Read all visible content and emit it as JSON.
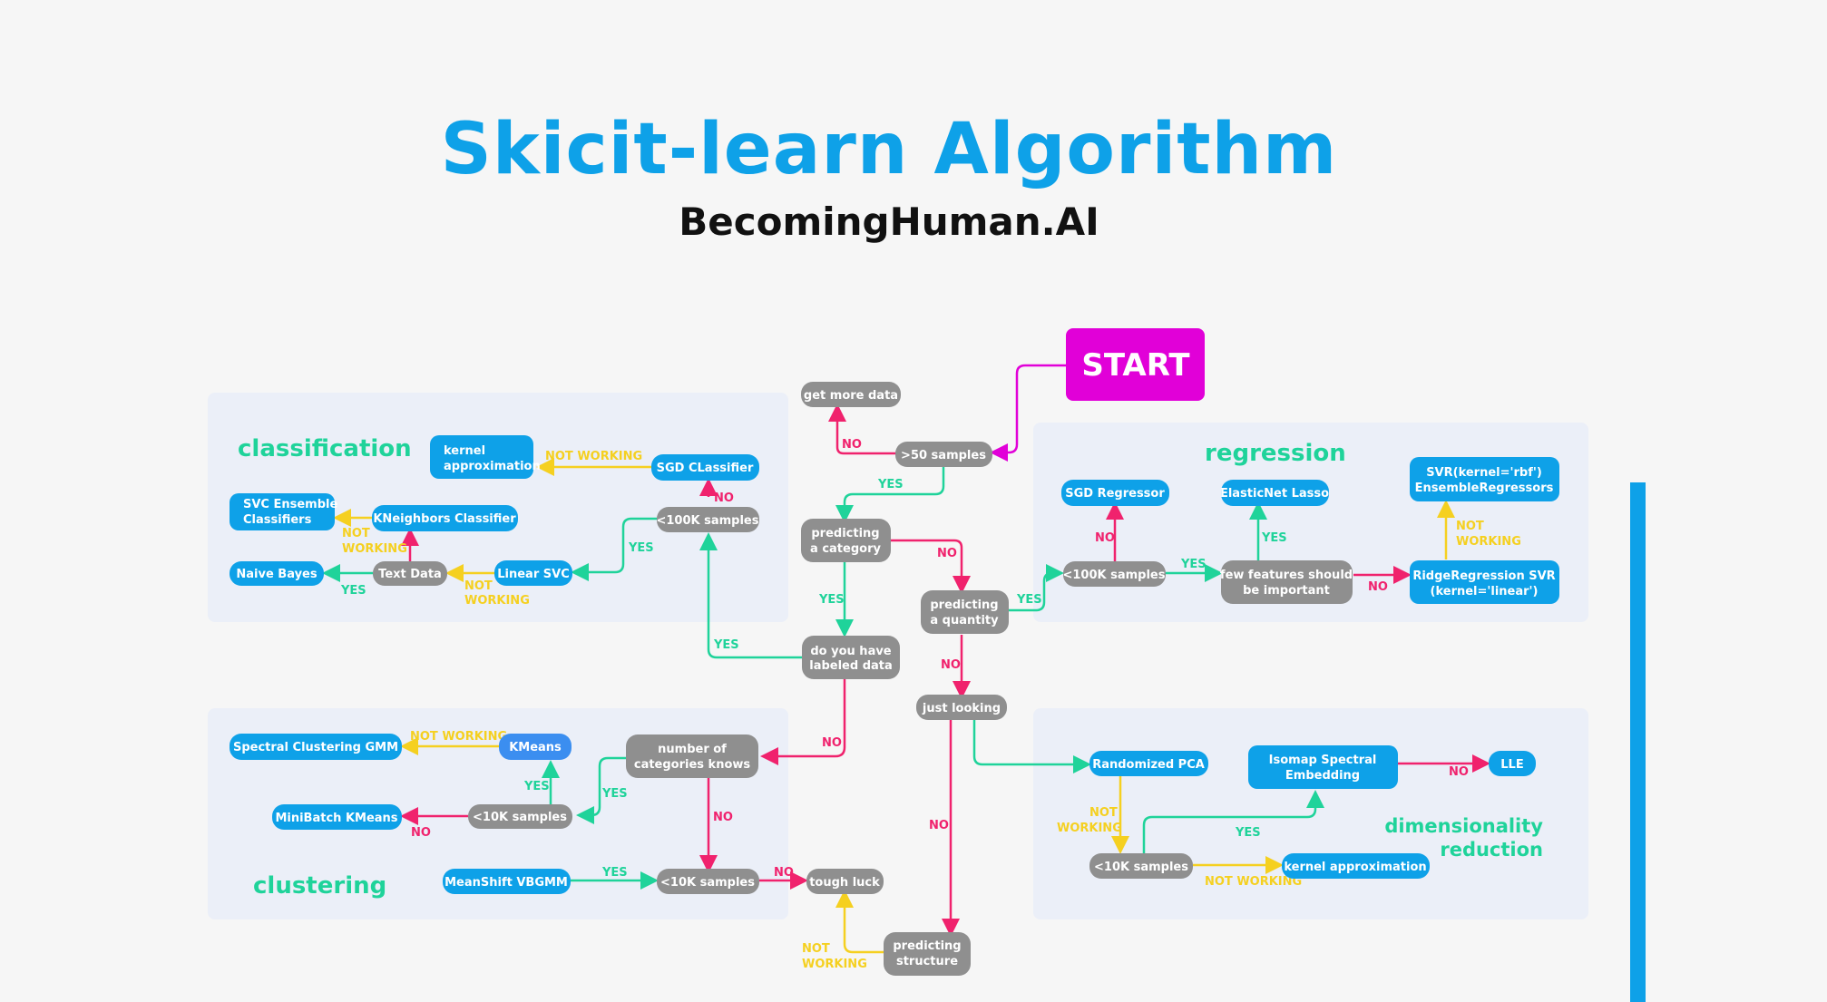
{
  "header": {
    "title": "Skicit-learn Algorithm",
    "subtitle": "BecomingHuman.AI"
  },
  "colors": {
    "title": "#0ea1e8",
    "blue_node": "#0ea1e8",
    "gray_node": "#8f8f8f",
    "start_node": "#e100d8",
    "yes": "#1fd39a",
    "no": "#f0226d",
    "not_working": "#f5d020",
    "panel": "#ebeff8",
    "section_label": "#1fd39a"
  },
  "sections": {
    "classification": "classification",
    "regression": "regression",
    "clustering": "clustering",
    "dimensionality": [
      "dimensionality",
      "reduction"
    ]
  },
  "nodes": {
    "start": "START",
    "get_more_data": "get more data",
    "gt50": ">50 samples",
    "predicting_category": [
      "predicting",
      "a category"
    ],
    "labeled_data": [
      "do you have",
      "labeled data"
    ],
    "predicting_quantity": [
      "predicting",
      "a quantity"
    ],
    "just_looking": "just looking",
    "predicting_structure": [
      "predicting",
      "structure"
    ],
    "tough_luck": "tough luck",
    "cls_lt100k": "<100K samples",
    "sgd_classifier": "SGD CLassifier",
    "kernel_approx_cls": [
      "kernel",
      "approximation"
    ],
    "linear_svc": "Linear SVC",
    "text_data": "Text Data",
    "naive_bayes": "Naive Bayes",
    "kneighbors": "KNeighbors Classifier",
    "svc_ensemble": [
      "SVC Ensemble",
      "Classifiers"
    ],
    "reg_lt100k": "<100K samples",
    "sgd_regressor": "SGD Regressor",
    "few_features": [
      "few features should",
      "be important"
    ],
    "elasticnet": "ElasticNet Lasso",
    "ridge": [
      "RidgeRegression SVR",
      "(kernel='linear')"
    ],
    "svr_rbf": [
      "SVR(kernel='rbf')",
      "EnsembleRegressors"
    ],
    "num_categories": [
      "number of",
      "categories knows"
    ],
    "clu_lt10k_a": "<10K samples",
    "clu_lt10k_b": "<10K samples",
    "kmeans": "KMeans",
    "spectral_gmm": "Spectral Clustering GMM",
    "minibatch": "MiniBatch KMeans",
    "meanshift": "MeanShift VBGMM",
    "randomized_pca": "Randomized PCA",
    "dim_lt10k": "<10K samples",
    "isomap": [
      "Isomap Spectral",
      "Embedding"
    ],
    "lle": "LLE",
    "kernel_approx_dim": "kernel approximation"
  },
  "edge_labels": {
    "yes": "YES",
    "no": "NO",
    "not_working": "NOT WORKING",
    "not": "NOT",
    "working": "WORKING"
  }
}
